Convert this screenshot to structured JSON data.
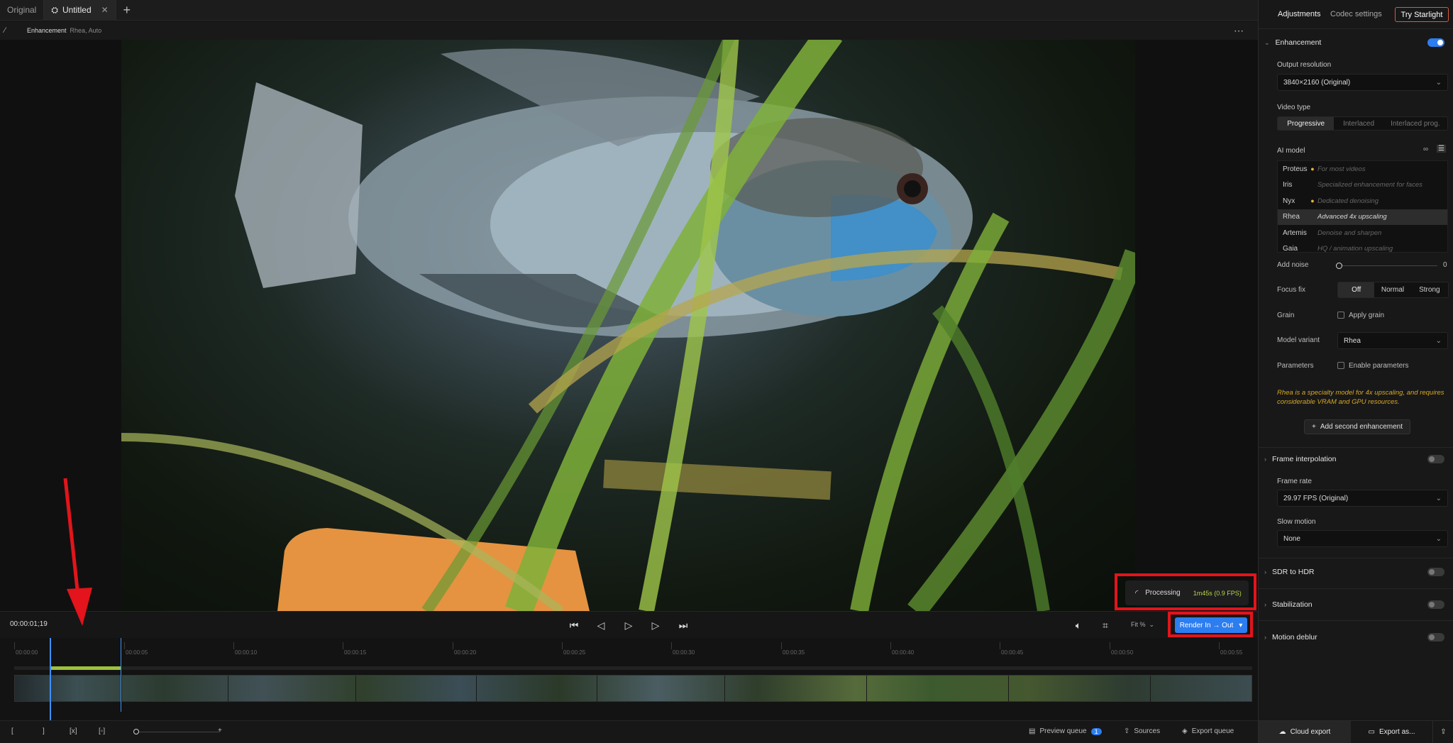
{
  "tabs": {
    "original": "Original",
    "untitled": "Untitled"
  },
  "subbar": {
    "label": "Enhancement",
    "sub": "Rhea, Auto"
  },
  "processing": {
    "label": "Processing",
    "time": "1m45s (0.9 FPS)"
  },
  "transport": {
    "timecode": "00:00:01;19",
    "fit": "Fit %",
    "render_label": "Render In → Out"
  },
  "ruler": [
    "00:00:00",
    "00:00:05",
    "00:00:10",
    "00:00:15",
    "00:00:20",
    "00:00:25",
    "00:00:30",
    "00:00:35",
    "00:00:40",
    "00:00:45",
    "00:00:50",
    "00:00:55"
  ],
  "bottombar": {
    "preview_queue": "Preview queue",
    "preview_count": "1",
    "sources": "Sources",
    "export_queue": "Export queue"
  },
  "panel": {
    "tab_adjustments": "Adjustments",
    "tab_codec": "Codec settings",
    "try_btn": "Try Starlight",
    "enhancement": "Enhancement",
    "output_resolution_label": "Output resolution",
    "output_resolution_value": "3840×2160 (Original)",
    "video_type_label": "Video type",
    "video_types": [
      "Progressive",
      "Interlaced",
      "Interlaced prog."
    ],
    "ai_model_label": "AI model",
    "models": [
      {
        "name": "Proteus",
        "desc": "For most videos",
        "dot": "●"
      },
      {
        "name": "Iris",
        "desc": "Specialized enhancement for faces",
        "dot": ""
      },
      {
        "name": "Nyx",
        "desc": "Dedicated denoising",
        "dot": "●"
      },
      {
        "name": "Rhea",
        "desc": "Advanced 4x upscaling",
        "dot": ""
      },
      {
        "name": "Artemis",
        "desc": "Denoise and sharpen",
        "dot": ""
      },
      {
        "name": "Gaia",
        "desc": "HQ / animation upscaling",
        "dot": ""
      }
    ],
    "add_noise_label": "Add noise",
    "add_noise_value": "0",
    "focus_fix_label": "Focus fix",
    "focus_options": [
      "Off",
      "Normal",
      "Strong"
    ],
    "grain_label": "Grain",
    "grain_check": "Apply grain",
    "model_variant_label": "Model variant",
    "model_variant_value": "Rhea",
    "parameters_label": "Parameters",
    "parameters_check": "Enable parameters",
    "note": "Rhea is a specialty model for 4x upscaling, and requires considerable VRAM and GPU resources.",
    "add_second": "Add second enhancement",
    "frame_interpolation": "Frame interpolation",
    "frame_rate_label": "Frame rate",
    "frame_rate_value": "29.97 FPS (Original)",
    "slow_motion_label": "Slow motion",
    "slow_motion_value": "None",
    "sdr_to_hdr": "SDR to HDR",
    "stabilization": "Stabilization",
    "motion_deblur": "Motion deblur",
    "cloud_export": "Cloud export",
    "export_as": "Export as..."
  },
  "colors": {
    "accent": "#2c7df0",
    "range": "#9cc23a",
    "highlight": "#e3141b",
    "note": "#d6a726"
  }
}
